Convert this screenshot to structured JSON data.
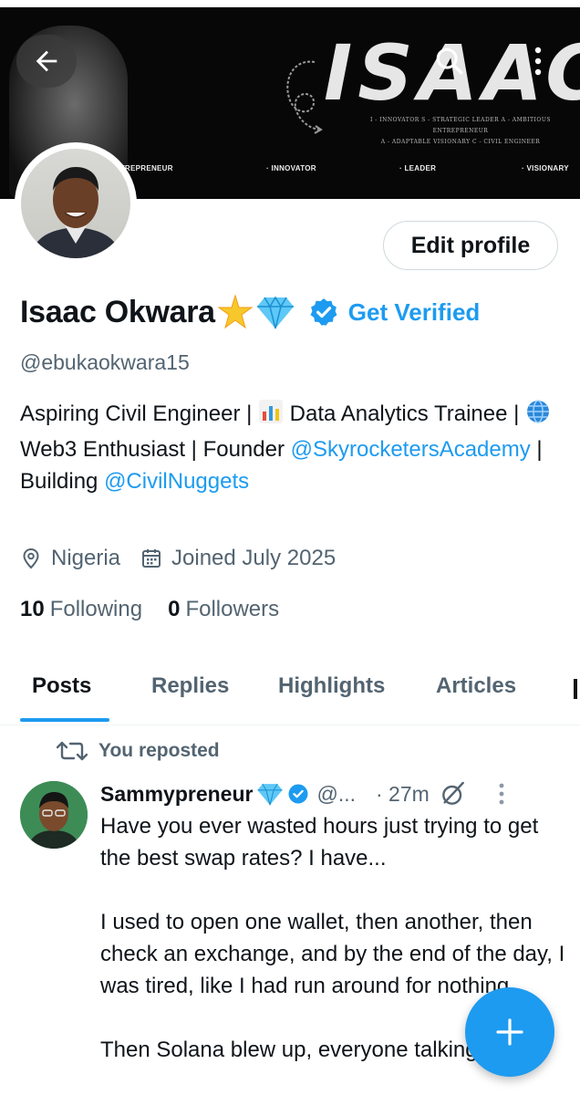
{
  "banner": {
    "logo_text": "ISAAC",
    "logo_line1": "I - INNOVATOR   S - STRATEGIC LEADER   A - AMBITIOUS ENTREPRENEUR",
    "logo_line2": "A - ADAPTABLE VISIONARY   C - CIVIL ENGINEER",
    "tags": [
      "ENTREPRENEUR",
      "· INNOVATOR",
      "· LEADER",
      "· VISIONARY"
    ]
  },
  "header": {
    "back_icon": "arrow-left-icon",
    "search_icon": "search-icon",
    "more_icon": "more-vertical-icon"
  },
  "profile": {
    "edit_label": "Edit profile",
    "name": "Isaac Okwara",
    "verify_label": "Get Verified",
    "handle": "@ebukaokwara15",
    "bio": {
      "p1": "Aspiring Civil Engineer | ",
      "p2": " Data Analytics Trainee | ",
      "p3": " Web3 Enthusiast | Founder ",
      "link1": "@SkyrocketersAcademy",
      "p4": " | Building ",
      "link2": "@CivilNuggets"
    },
    "location": "Nigeria",
    "joined": "Joined July 2025",
    "following_count": "10",
    "following_label": "Following",
    "followers_count": "0",
    "followers_label": "Followers"
  },
  "tabs": [
    "Posts",
    "Replies",
    "Highlights",
    "Articles"
  ],
  "active_tab": "Posts",
  "post": {
    "repost_label": "You reposted",
    "author": "Sammypreneur",
    "handle": "@...",
    "time": "· 27m",
    "line1": "Have you ever wasted hours just trying to get the best swap rates? I have...",
    "line2": "I used to open one wallet, then another, then check an exchange, and by the end of the day, I was tired, like I had run around for nothing",
    "line3": "Then Solana blew up, everyone talking"
  },
  "colors": {
    "accent": "#1d9bf0",
    "text": "#0f1419",
    "muted": "#536471",
    "border": "#cfd9de"
  },
  "fab_icon": "plus-icon"
}
